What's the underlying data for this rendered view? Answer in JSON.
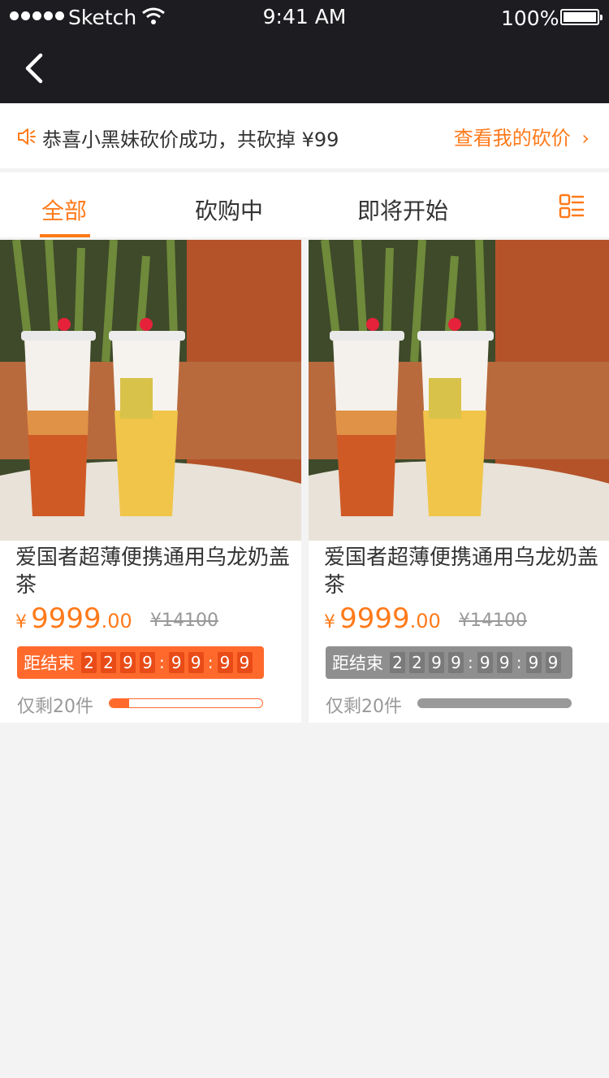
{
  "status_bar": {
    "carrier": "Sketch",
    "time": "9:41 AM",
    "battery": "100%"
  },
  "notice": {
    "text": "恭喜小黑妹砍价成功，共砍掉 ¥99",
    "link": "查看我的砍价"
  },
  "tabs": [
    {
      "label": "全部",
      "active": true
    },
    {
      "label": "砍购中",
      "active": false
    },
    {
      "label": "即将开始",
      "active": false
    }
  ],
  "products": [
    {
      "title": "爱国者超薄便携通用乌龙奶盖茶",
      "currency": "¥",
      "price_int": "9999",
      "price_dec": ".00",
      "original_price": "¥14100",
      "countdown_label": "距结束",
      "countdown_digits": [
        "2",
        "2",
        "9",
        "9",
        ":",
        "9",
        "9",
        ":",
        "9",
        "9"
      ],
      "stock_text": "仅剩20件",
      "progress": 0.13,
      "status": "active"
    },
    {
      "title": "爱国者超薄便携通用乌龙奶盖茶",
      "currency": "¥",
      "price_int": "9999",
      "price_dec": ".00",
      "original_price": "¥14100",
      "countdown_label": "距结束",
      "countdown_digits": [
        "2",
        "2",
        "9",
        "9",
        ":",
        "9",
        "9",
        ":",
        "9",
        "9"
      ],
      "stock_text": "仅剩20件",
      "progress": 1.0,
      "status": "inactive"
    }
  ],
  "colors": {
    "accent": "#ff7a1a",
    "countdown_active": "#ff6a2c",
    "countdown_inactive": "#8f8f8f",
    "header": "#1d1c21"
  }
}
